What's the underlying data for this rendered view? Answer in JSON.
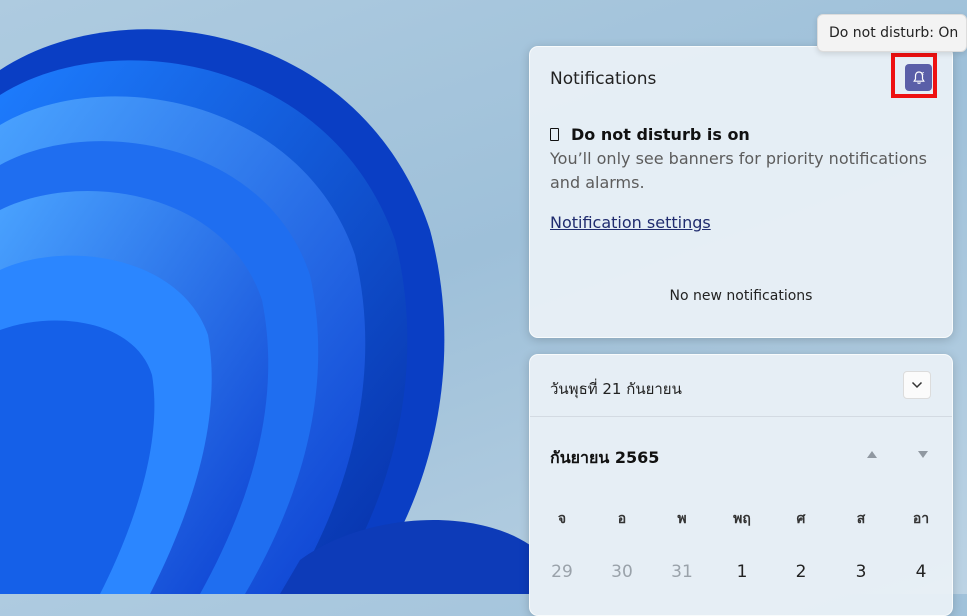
{
  "tooltip": {
    "text": "Do not disturb: On"
  },
  "notifications": {
    "title": "Notifications",
    "dnd_heading": "Do not disturb is on",
    "dnd_description": "You’ll only see banners for priority notifications and alarms.",
    "settings_link": "Notification settings",
    "empty_text": "No new notifications",
    "dnd_button_icon": "bell-snooze-icon",
    "dnd_button_color": "#5a5fa8",
    "highlight_color": "#ee1111"
  },
  "calendar": {
    "full_date": "วันพุธที่ 21 กันยายน",
    "month_year": "กันยายน 2565",
    "weekdays": [
      "จ",
      "อ",
      "พ",
      "พฤ",
      "ศ",
      "ส",
      "อา"
    ],
    "days": [
      {
        "label": "29",
        "muted": true
      },
      {
        "label": "30",
        "muted": true
      },
      {
        "label": "31",
        "muted": true
      },
      {
        "label": "1",
        "muted": false
      },
      {
        "label": "2",
        "muted": false
      },
      {
        "label": "3",
        "muted": false
      },
      {
        "label": "4",
        "muted": false
      }
    ],
    "expand_icon": "chevron-down-icon",
    "prev_icon": "triangle-up-icon",
    "next_icon": "triangle-down-icon"
  }
}
